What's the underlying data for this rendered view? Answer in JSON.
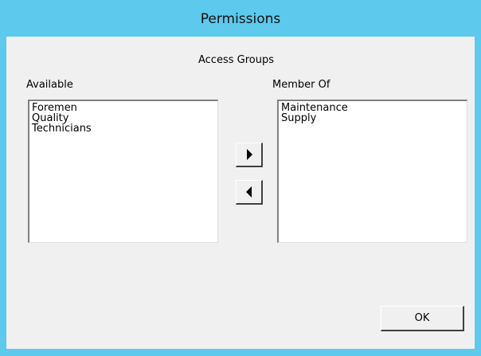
{
  "window": {
    "title": "Permissions",
    "accent_color": "#5dc9ec",
    "background_color": "#f0f0f0"
  },
  "dialog": {
    "group_heading": "Access Groups",
    "available": {
      "label": "Available",
      "items": [
        "Foremen",
        "Quality",
        "Technicians"
      ]
    },
    "member_of": {
      "label": "Member Of",
      "items": [
        "Maintenance",
        "Supply"
      ]
    },
    "buttons": {
      "add_icon": "arrow-right-icon",
      "remove_icon": "arrow-left-icon",
      "ok_label": "OK"
    }
  }
}
